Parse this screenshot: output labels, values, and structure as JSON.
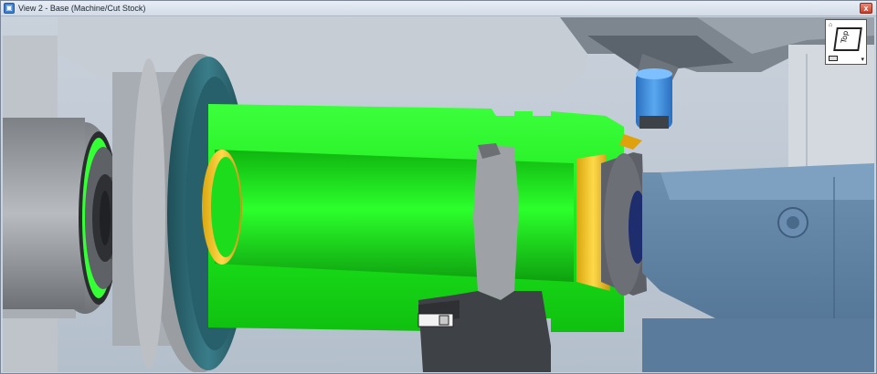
{
  "window": {
    "title": "View 2 - Base (Machine/Cut Stock)",
    "close_label": "x",
    "app_icon": "app-view-icon"
  },
  "viewcube": {
    "face_label": "Top",
    "home_glyph": "⌂",
    "dropdown_glyph": "▾",
    "icon": "view-cube-icon"
  },
  "colors": {
    "stock": "#1cf81c",
    "machine_gray": "#8b8d91",
    "chuck_teal": "#2f6c78",
    "tailstock_blue": "#5f84a6",
    "tool_blue": "#3a86d6",
    "yellow_face": "#f0c419",
    "background": "#c3cbd6"
  }
}
